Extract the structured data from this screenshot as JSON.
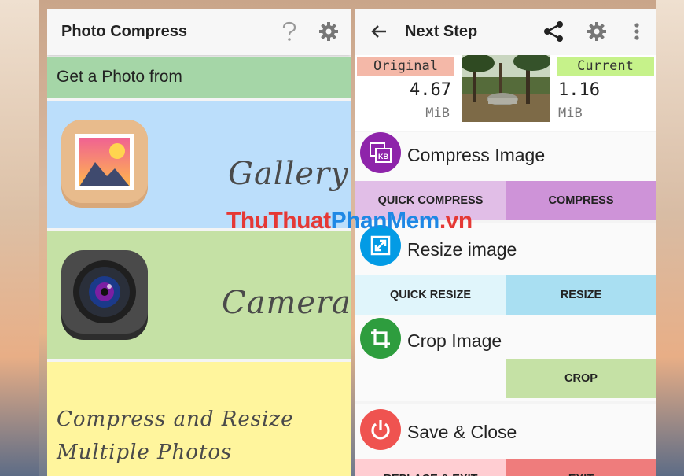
{
  "left_screen": {
    "appbar": {
      "title": "Photo Compress",
      "help_icon": "help-icon",
      "settings_icon": "gear-icon"
    },
    "header": "Get a Photo from",
    "gallery": {
      "label": "Gallery",
      "icon": "gallery-icon"
    },
    "camera": {
      "label": "Camera",
      "icon": "camera-icon"
    },
    "multi": {
      "label": "Compress and Resize Multiple Photos"
    }
  },
  "right_screen": {
    "appbar": {
      "title": "Next Step",
      "back_icon": "arrow-back-icon",
      "share_icon": "share-icon",
      "settings_icon": "gear-icon",
      "more_icon": "more-vert-icon"
    },
    "original": {
      "label": "Original",
      "value": "4.67",
      "unit": "MiB"
    },
    "current": {
      "label": "Current",
      "value": "1.16",
      "unit": "MiB"
    },
    "compress": {
      "title": "Compress Image",
      "quick": "QUICK COMPRESS",
      "action": "COMPRESS"
    },
    "resize": {
      "title": "Resize image",
      "quick": "QUICK RESIZE",
      "action": "RESIZE"
    },
    "crop": {
      "title": "Crop Image",
      "action": "CROP"
    },
    "save": {
      "title": "Save & Close",
      "replace": "REPLACE & EXIT",
      "exit": "EXIT"
    }
  },
  "watermark": {
    "part1": "ThuThuat",
    "part2": "PhanMem",
    "part3": ".vn"
  },
  "colors": {
    "green_header": "#a5d6a7",
    "gallery_bg": "#bbdefb",
    "camera_bg": "#c5e1a5",
    "multi_bg": "#fff59d",
    "compress_accent": "#8e24aa",
    "resize_accent": "#039be5",
    "crop_accent": "#2e7d32",
    "save_accent": "#e53935"
  }
}
